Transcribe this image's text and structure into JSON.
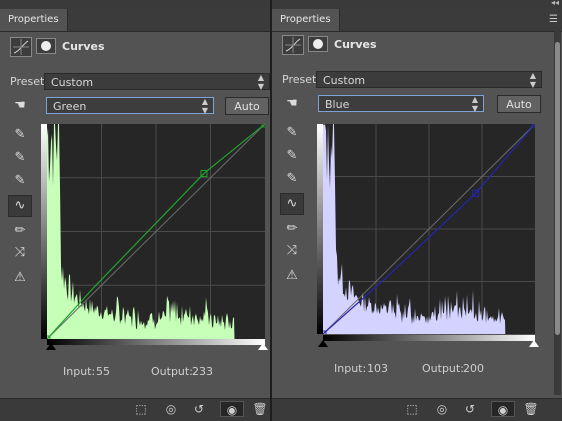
{
  "panels": [
    {
      "tab_label": "Properties",
      "title": "Curves",
      "preset_label": "Preset:",
      "preset_value": "Custom",
      "channel_value": "Green",
      "auto_label": "Auto",
      "input_label": "Input:",
      "input_value": "55",
      "output_label": "Output:",
      "output_value": "233",
      "curve_color": "#1fa52c",
      "histogram_color": "#c6ffb8"
    },
    {
      "tab_label": "Properties",
      "title": "Curves",
      "preset_label": "Preset:",
      "preset_value": "Custom",
      "channel_value": "Blue",
      "auto_label": "Auto",
      "input_label": "Input:",
      "input_value": "103",
      "output_label": "Output:",
      "output_value": "200",
      "curve_color": "#2525b0",
      "histogram_color": "#d4d2ff"
    }
  ],
  "icons": {
    "adjustment": "curves-adjustment-icon",
    "mask": "layer-mask-icon",
    "on_image": "targeted-adjustment-hand-icon",
    "eyedroppers": [
      "black-point-eyedropper-icon",
      "gray-point-eyedropper-icon",
      "white-point-eyedropper-icon"
    ],
    "curve_tool": "curve-points-icon",
    "pencil": "pencil-icon",
    "smooth": "smooth-curve-icon",
    "clipping": "clipping-warning-icon",
    "footer": [
      "clip-to-layer-icon",
      "view-previous-state-icon",
      "reset-icon",
      "visibility-eye-icon",
      "trash-icon"
    ]
  }
}
